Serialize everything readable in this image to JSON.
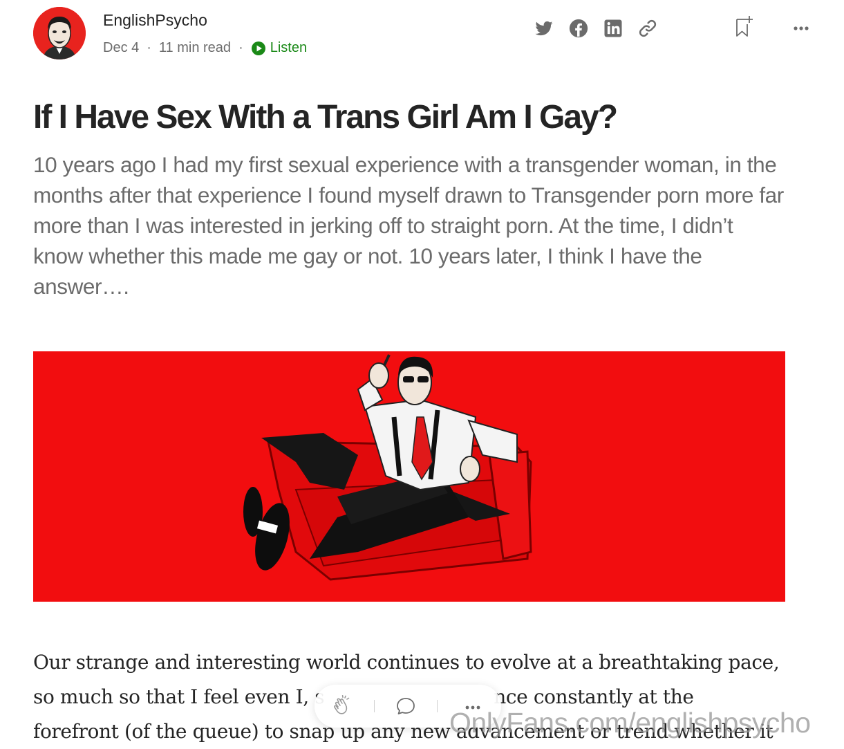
{
  "author": {
    "name": "EnglishPsycho",
    "avatar_icon": "avatar-portrait"
  },
  "meta": {
    "date": "Dec 4",
    "read_time": "11 min read",
    "separator": "·",
    "listen_label": "Listen"
  },
  "actions": [
    {
      "name": "twitter-share-icon"
    },
    {
      "name": "facebook-share-icon"
    },
    {
      "name": "linkedin-share-icon"
    },
    {
      "name": "copy-link-icon"
    },
    {
      "name": "bookmark-add-icon"
    },
    {
      "name": "more-options-icon"
    }
  ],
  "article": {
    "title": "If I Have Sex With a Trans Girl Am I Gay?",
    "subtitle": "10 years ago I had my first sexual experience with a transgender woman, in the months after that experience I found myself drawn to Transgender porn more far more than I was interested in jerking off to straight porn. At the time, I didn’t know whether this made me gay or not. 10 years later, I think I have the answer….",
    "hero_image": "illustration-man-reclining-on-red-sofa",
    "body_lines": [
      "Our strange and interesting world continues to evolve at a breathtaking pace,",
      "so much so that I feel even I, s",
      "nce constantly at the",
      "forefront (of the queue) to snap up any new advancement or trend whether it"
    ]
  },
  "floating_bar": {
    "clap_icon": "clap-icon",
    "comment_icon": "comment-icon",
    "more_icon": "more-icon"
  },
  "watermark": "OnlyFans.com/englishpsycho",
  "colors": {
    "accent_green": "#1a8917",
    "hero_red": "#f20d0f",
    "text_primary": "#242424",
    "text_secondary": "#6b6b6b"
  }
}
